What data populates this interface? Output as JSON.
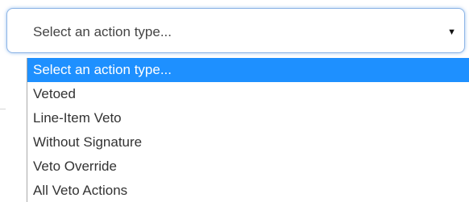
{
  "select": {
    "current_value": "Select an action type...",
    "arrow_icon": "triangle-down-icon"
  },
  "dropdown": {
    "selected_index": 0,
    "options": [
      "Select an action type...",
      "Vetoed",
      "Line-Item Veto",
      "Without Signature",
      "Veto Override",
      "All Veto Actions"
    ]
  },
  "colors": {
    "selection_highlight": "#1e90ff",
    "focus_border": "#8fb6e6"
  }
}
